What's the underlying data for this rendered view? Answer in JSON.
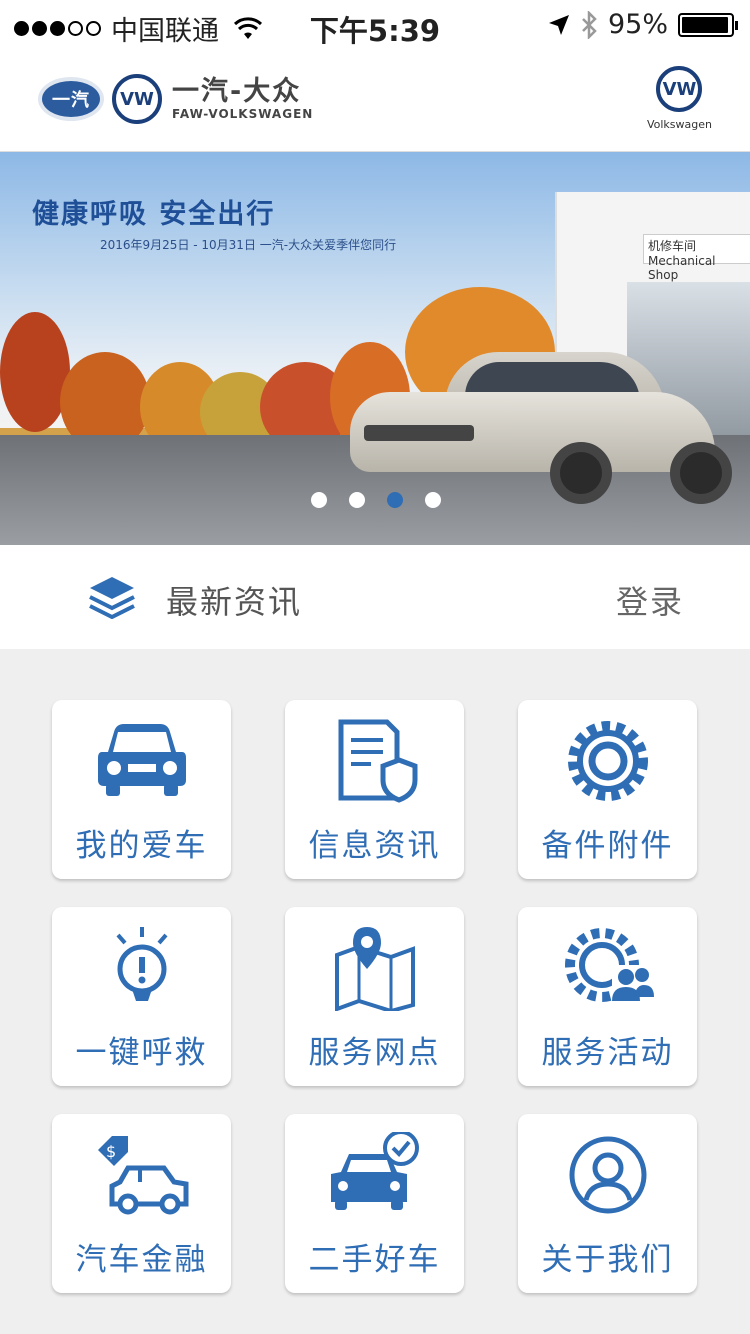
{
  "status_bar": {
    "carrier": "中国联通",
    "time": "下午5:39",
    "battery_percent": "95%",
    "battery_level": 0.95
  },
  "header": {
    "brand_cn": "一汽-大众",
    "brand_en": "FAW-VOLKSWAGEN",
    "faw_logo_text": "一汽",
    "vw_logo_text": "VW",
    "vw_wordmark": "Volkswagen"
  },
  "banner": {
    "headline": "健康呼吸  安全出行",
    "subline": "2016年9月25日 - 10月31日  一汽-大众关爱季伴您同行",
    "shop_sign": "机修车间 Mechanical Shop",
    "slide_count": 4,
    "active_slide": 3
  },
  "news_bar": {
    "title": "最新资讯",
    "login": "登录"
  },
  "menu": [
    {
      "label": "我的爱车",
      "icon": "car-icon"
    },
    {
      "label": "信息资讯",
      "icon": "document-shield-icon"
    },
    {
      "label": "备件附件",
      "icon": "gear-icon"
    },
    {
      "label": "一键呼救",
      "icon": "alert-bulb-icon"
    },
    {
      "label": "服务网点",
      "icon": "map-pin-icon"
    },
    {
      "label": "服务活动",
      "icon": "gear-people-icon"
    },
    {
      "label": "汽车金融",
      "icon": "car-price-tag-icon"
    },
    {
      "label": "二手好车",
      "icon": "car-check-icon"
    },
    {
      "label": "关于我们",
      "icon": "user-circle-icon"
    }
  ],
  "colors": {
    "accent": "#2f6db5",
    "brand_blue": "#1f4f97",
    "background": "#efefef"
  }
}
